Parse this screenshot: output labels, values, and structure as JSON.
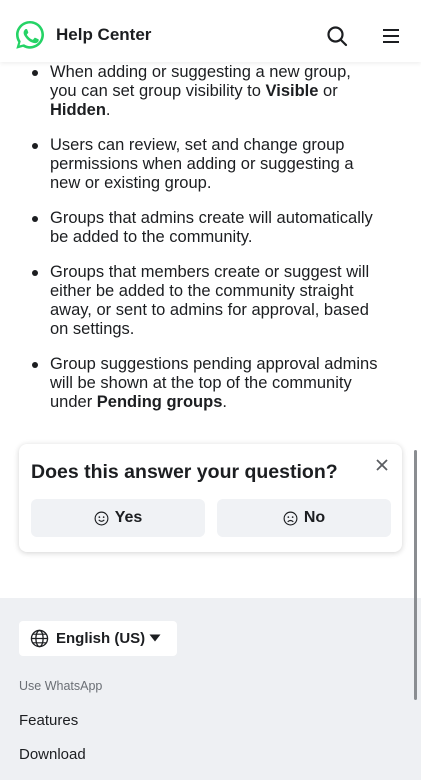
{
  "header": {
    "title": "Help Center",
    "logo_icon": "whatsapp-logo",
    "search_icon": "search-icon",
    "menu_icon": "hamburger-menu-icon"
  },
  "content": {
    "bullets": [
      {
        "before": "When adding or suggesting a new group, you can set group visibility to ",
        "bold1": "Visible",
        "middle": " or ",
        "bold2": "Hidden",
        "after": "."
      },
      {
        "text": "Users can review, set and change group permissions when adding or suggesting a new or existing group."
      },
      {
        "text": "Groups that admins create will automatically be added to the community."
      },
      {
        "text": "Groups that members create or suggest will either be added to the community straight away, or sent to admins for approval, based on settings."
      },
      {
        "before": "Group suggestions pending approval admins will be shown at the top of the community under ",
        "bold": "Pending groups",
        "after": "."
      }
    ]
  },
  "feedback": {
    "question": "Does this answer your question?",
    "yes_label": "Yes",
    "no_label": "No"
  },
  "footer": {
    "language": "English (US)",
    "section_heading": "Use WhatsApp",
    "links": [
      "Features",
      "Download"
    ]
  },
  "colors": {
    "brand_green": "#25D366",
    "footer_bg": "#eef0f3",
    "button_bg": "#f0f2f5",
    "text": "#1c1e21"
  }
}
